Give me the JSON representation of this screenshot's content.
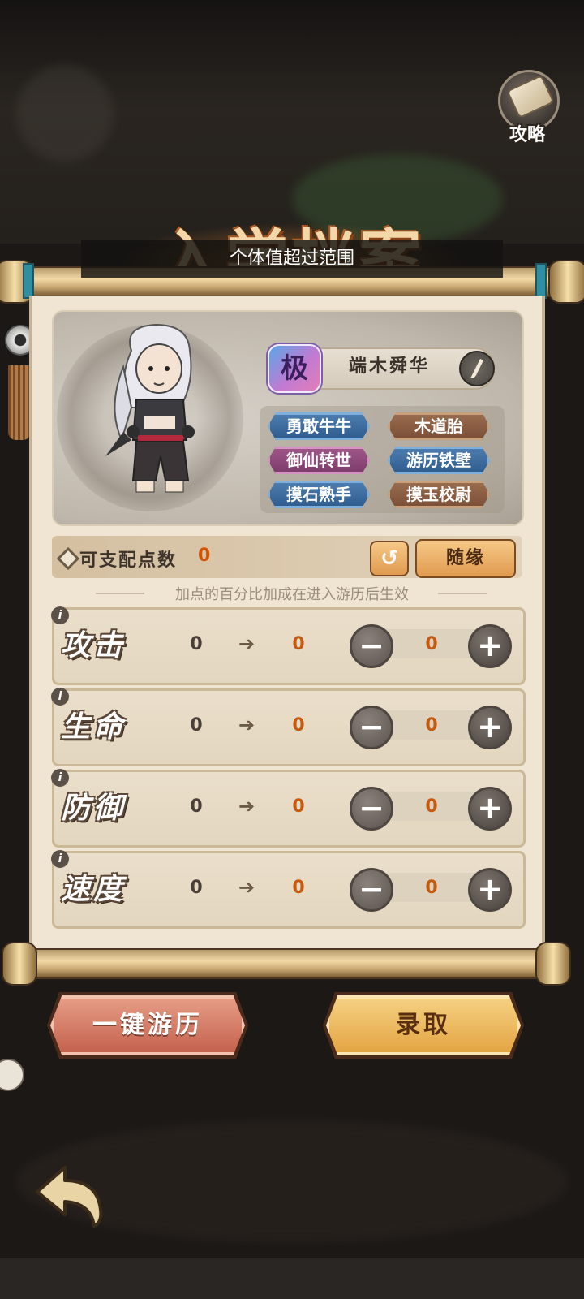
{
  "toast": "个体值超过范围",
  "title_art": "入学档案",
  "guide_button": {
    "label": "攻略",
    "icon": "scroll-icon"
  },
  "character": {
    "rank": "极",
    "name": "端木舜华",
    "traits": [
      {
        "label": "勇敢牛牛",
        "color": "blue"
      },
      {
        "label": "木道胎",
        "color": "brown"
      },
      {
        "label": "御仙转世",
        "color": "purple"
      },
      {
        "label": "游历铁壁",
        "color": "blue"
      },
      {
        "label": "摸石熟手",
        "color": "blue"
      },
      {
        "label": "摸玉校尉",
        "color": "brown"
      }
    ]
  },
  "points": {
    "label": "可支配点数",
    "value": "0"
  },
  "reset_button": {
    "icon": "undo-icon",
    "label": "↺"
  },
  "random_button": {
    "label": "随缘"
  },
  "hint": "加点的百分比加成在进入游历后生效",
  "stats": [
    {
      "name": "攻击",
      "from": "0",
      "arrow": "➔",
      "to": "0",
      "alloc": "0",
      "minus": "−",
      "plus": "+",
      "info": "i"
    },
    {
      "name": "生命",
      "from": "0",
      "arrow": "➔",
      "to": "0",
      "alloc": "0",
      "minus": "−",
      "plus": "+",
      "info": "i"
    },
    {
      "name": "防御",
      "from": "0",
      "arrow": "➔",
      "to": "0",
      "alloc": "0",
      "minus": "−",
      "plus": "+",
      "info": "i"
    },
    {
      "name": "速度",
      "from": "0",
      "arrow": "➔",
      "to": "0",
      "alloc": "0",
      "minus": "−",
      "plus": "+",
      "info": "i"
    }
  ],
  "buttons": {
    "auto_travel": "一键游历",
    "admit": "录取"
  },
  "colors": {
    "accent_orange": "#d35400",
    "paper": "#efe5d2",
    "button_red": "#c25e4a",
    "button_gold": "#e3a23f"
  }
}
